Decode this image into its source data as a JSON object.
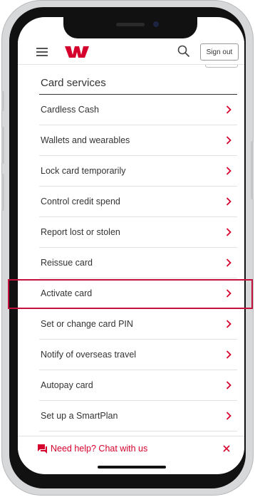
{
  "header": {
    "sign_out_label": "Sign out",
    "icons": [
      "menu-icon",
      "westpac-logo",
      "search-icon"
    ],
    "brand_color": "#d5002b"
  },
  "card_services": {
    "title": "Card services",
    "items": [
      {
        "label": "Cardless Cash"
      },
      {
        "label": "Wallets and wearables"
      },
      {
        "label": "Lock card temporarily"
      },
      {
        "label": "Control credit spend"
      },
      {
        "label": "Report lost or stolen"
      },
      {
        "label": "Reissue card"
      },
      {
        "label": "Activate card",
        "highlighted": true
      },
      {
        "label": "Set or change card PIN"
      },
      {
        "label": "Notify of overseas travel"
      },
      {
        "label": "Autopay card"
      },
      {
        "label": "Set up a SmartPlan"
      }
    ]
  },
  "chat": {
    "label": "Need help? Chat with us",
    "icon": "chat-bubble-icon"
  },
  "highlight_color": "#c4103c"
}
